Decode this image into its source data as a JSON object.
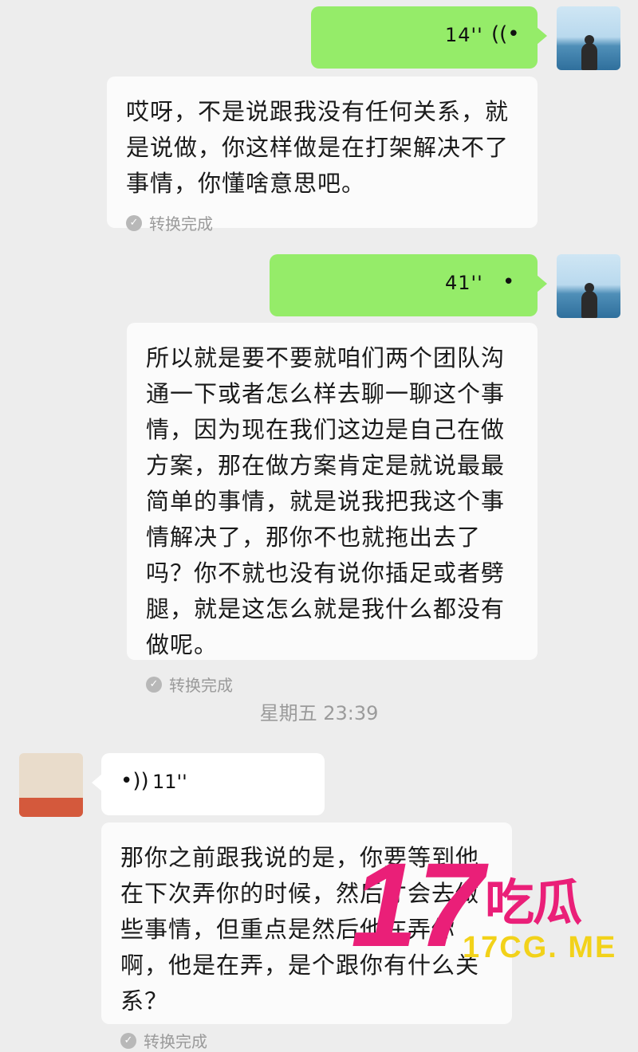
{
  "messages": [
    {
      "voice_duration": "14''"
    },
    {
      "transcript": "哎呀，不是说跟我没有任何关系，就是说做，你这样做是在打架解决不了事情，你懂啥意思吧。",
      "status": "转换完成"
    },
    {
      "voice_duration": "41''"
    },
    {
      "transcript": "所以就是要不要就咱们两个团队沟通一下或者怎么样去聊一聊这个事情，因为现在我们这边是自己在做方案，那在做方案肯定是就说最最简单的事情，就是说我把我这个事情解决了，那你不也就拖出去了吗？你不就也没有说你插足或者劈腿，就是这怎么就是我什么都没有做呢。",
      "status": "转换完成"
    },
    {
      "timestamp": "星期五 23:39"
    },
    {
      "voice_duration": "11''"
    },
    {
      "transcript": "那你之前跟我说的是，你要等到他在下次弄你的时候，然后才会去做些事情，但重点是然后他在弄你啊，他是在弄，是个跟你有什么关系？",
      "status": "转换完成"
    }
  ],
  "icons": {
    "voice_out": "voice-wave-icon",
    "voice_in": "voice-wave-icon",
    "check": "check-circle-icon"
  },
  "colors": {
    "outgoing_bubble": "#95ec69",
    "incoming_bubble": "#ffffff",
    "background": "#ededed",
    "watermark": "#ea1f78"
  },
  "watermark": {
    "number": "17",
    "chinese": "吃瓜",
    "url": "17CG. ME"
  }
}
